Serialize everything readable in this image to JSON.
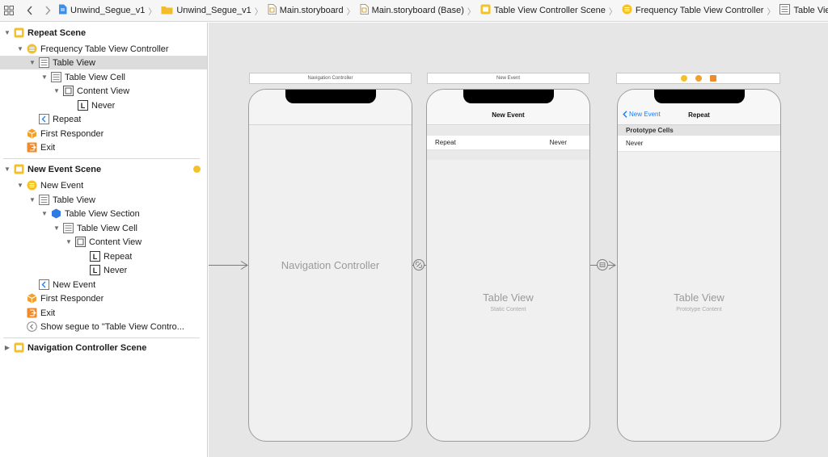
{
  "breadcrumbs": [
    {
      "label": "Unwind_Segue_v1",
      "icon": "project-file-icon"
    },
    {
      "label": "Unwind_Segue_v1",
      "icon": "folder-icon"
    },
    {
      "label": "Main.storyboard",
      "icon": "storyboard-file-icon"
    },
    {
      "label": "Main.storyboard (Base)",
      "icon": "storyboard-file-icon"
    },
    {
      "label": "Table View Controller Scene",
      "icon": "scene-icon"
    },
    {
      "label": "Frequency Table View Controller",
      "icon": "view-controller-icon"
    },
    {
      "label": "Table View",
      "icon": "table-view-icon"
    }
  ],
  "outline": {
    "repeat_scene": "Repeat Scene",
    "frequency_tvc": "Frequency Table View Controller",
    "table_view_1": "Table View",
    "table_view_cell_1": "Table View Cell",
    "content_view_1": "Content View",
    "never_1": "Never",
    "repeat_exit_segue": "Repeat",
    "first_responder_1": "First Responder",
    "exit_1": "Exit",
    "new_event_scene": "New Event Scene",
    "new_event_vc": "New Event",
    "table_view_2": "Table View",
    "table_view_section": "Table View Section",
    "table_view_cell_2": "Table View Cell",
    "content_view_2": "Content View",
    "repeat_label": "Repeat",
    "never_2": "Never",
    "new_event_back": "New Event",
    "first_responder_2": "First Responder",
    "exit_2": "Exit",
    "show_segue": "Show segue to \"Table View Contro...",
    "nav_controller_scene": "Navigation Controller Scene"
  },
  "canvas": {
    "nav_controller": {
      "bar_title": "Navigation Controller",
      "label": "Navigation Controller"
    },
    "new_event": {
      "bar_title": "New Event",
      "nav_title": "New Event",
      "cell_left": "Repeat",
      "cell_right": "Never",
      "label": "Table View",
      "sublabel": "Static Content"
    },
    "repeat": {
      "back_label": "New Event",
      "nav_title": "Repeat",
      "section_header": "Prototype Cells",
      "cell_text": "Never",
      "label": "Table View",
      "sublabel": "Prototype Content"
    }
  },
  "colors": {
    "accent": "#147efb",
    "scene_yellow": "#f5c12a",
    "responder_orange": "#f0a030",
    "exit_orange": "#ef8b2c",
    "selection": "#dcdcdc",
    "canvas": "#e6e6e6"
  }
}
